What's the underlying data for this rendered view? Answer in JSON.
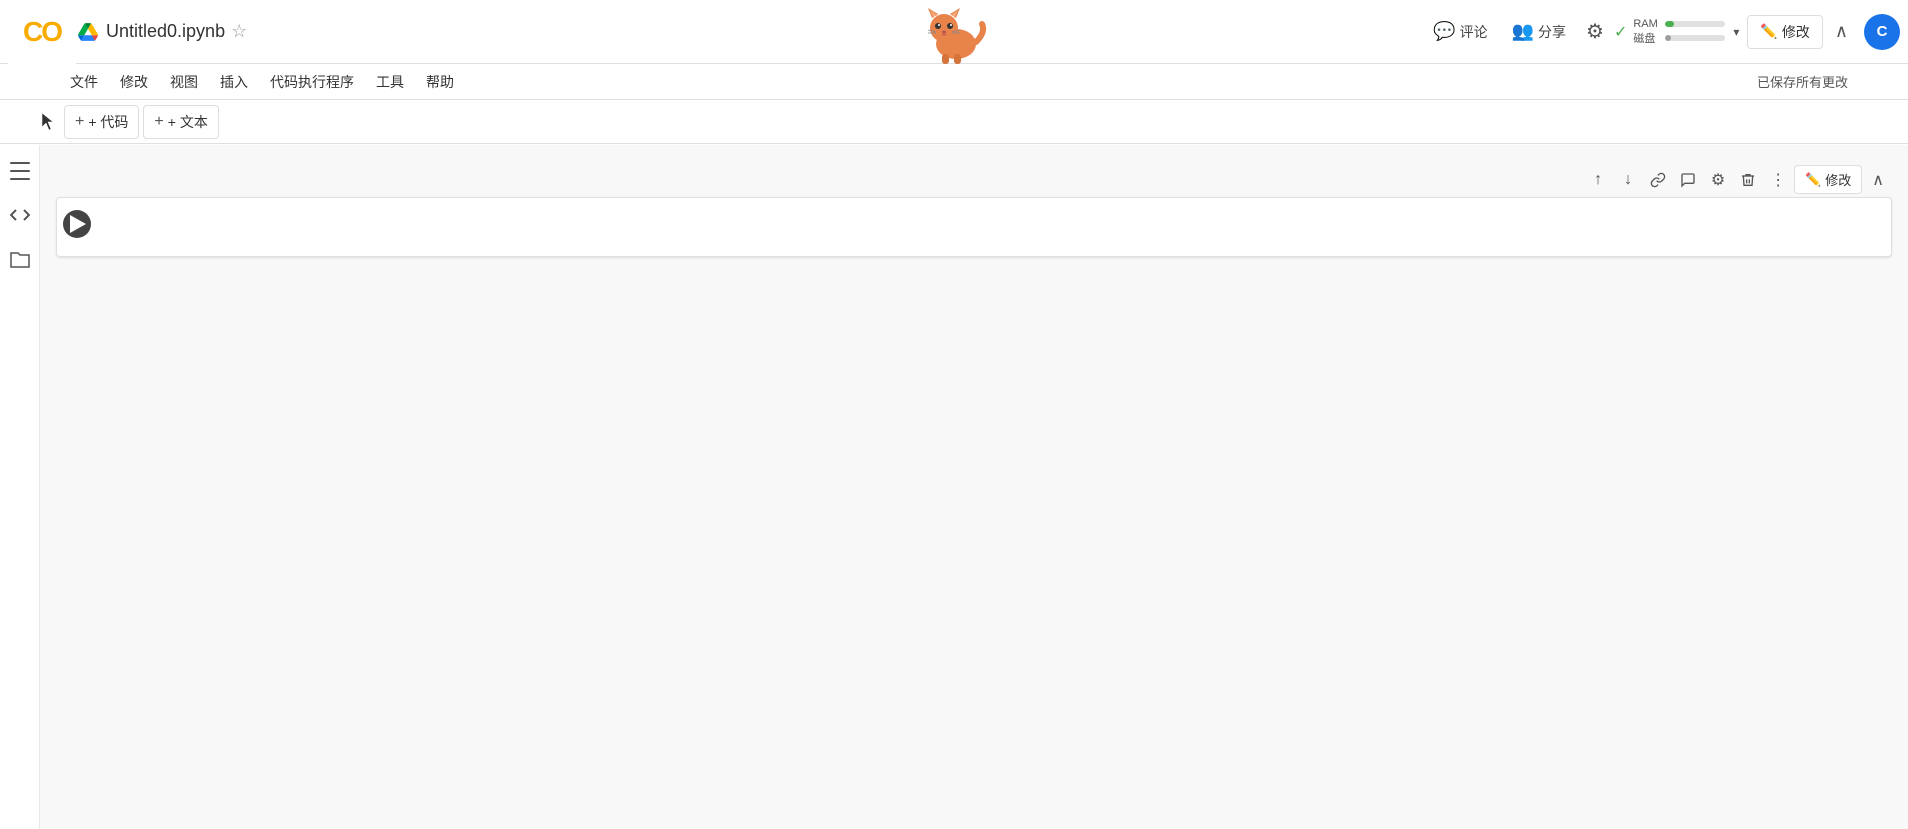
{
  "topbar": {
    "logo_text": "CO",
    "notebook_title": "Untitled0.ipynb",
    "save_status": "已保存所有更改",
    "comment_label": "评论",
    "share_label": "分享",
    "edit_label": "修改",
    "ram_label": "RAM",
    "disk_label": "磁盘",
    "user_initial": "C"
  },
  "menubar": {
    "items": [
      "文件",
      "修改",
      "视图",
      "插入",
      "代码执行程序",
      "工具",
      "帮助"
    ]
  },
  "toolbar": {
    "add_code_label": "+ 代码",
    "add_text_label": "+ 文本"
  },
  "sidebar": {
    "icons": [
      "menu",
      "code",
      "folder"
    ]
  },
  "cell": {
    "placeholder": ""
  },
  "cell_actions": {
    "move_up": "↑",
    "move_down": "↓",
    "link": "🔗",
    "comment": "💬",
    "settings": "⚙",
    "delete": "🗑",
    "more": "⋮",
    "edit_label": "修改"
  }
}
